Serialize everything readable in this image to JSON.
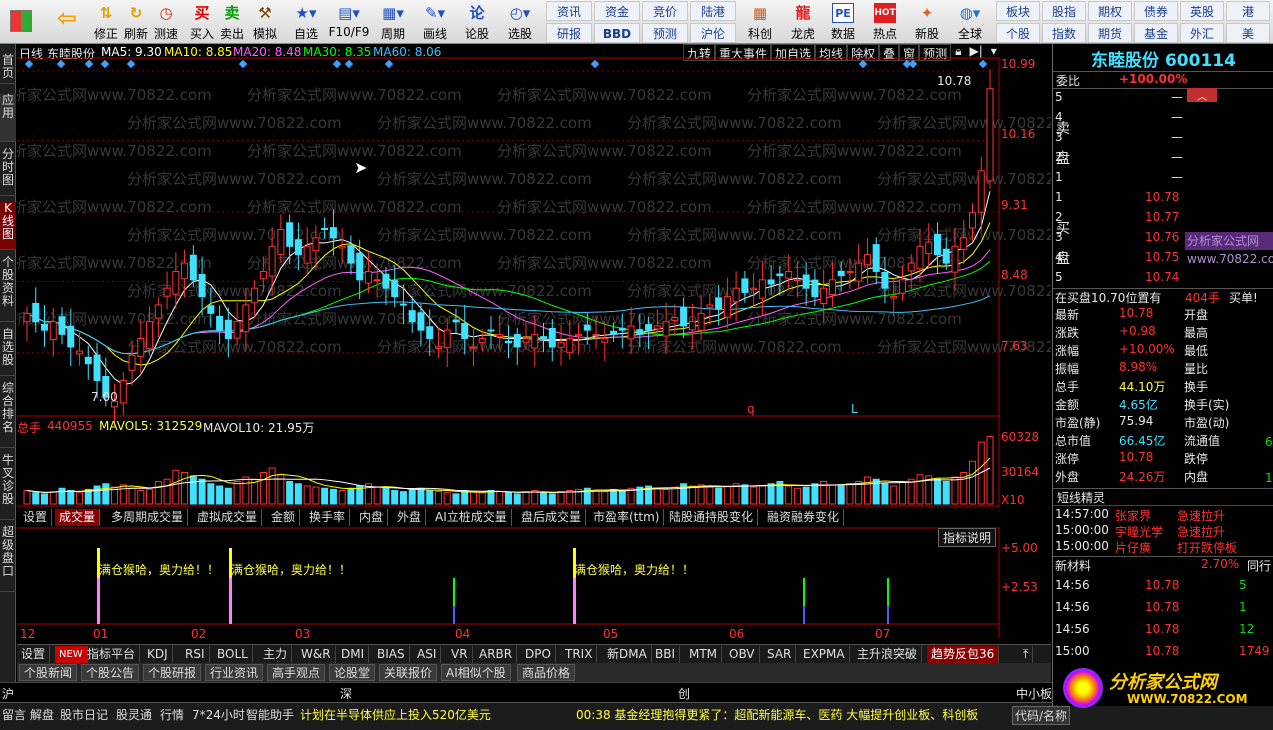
{
  "toolbar": {
    "buttons": [
      {
        "name": "home-button",
        "icon": "windows-grid-icon",
        "label": ""
      },
      {
        "name": "back-button",
        "icon": "back-arrow-icon",
        "label": ""
      },
      {
        "name": "adjust-button",
        "icon": "up-down-arrow-icon",
        "label": "修正"
      },
      {
        "name": "refresh-button",
        "icon": "refresh-icon",
        "label": "刷新"
      },
      {
        "name": "clock-button",
        "icon": "clock-icon",
        "label": "测速"
      },
      {
        "name": "buy-button",
        "icon": "buy-icon",
        "label": "买入",
        "glyph": "买"
      },
      {
        "name": "sell-button",
        "icon": "sell-icon",
        "label": "卖出",
        "glyph": "卖"
      },
      {
        "name": "simulate-button",
        "icon": "hammer-icon",
        "label": "模拟"
      },
      {
        "name": "watchlist-button",
        "icon": "star-icon",
        "label": "自选"
      },
      {
        "name": "f10-button",
        "icon": "f10-icon",
        "label": "F10/F9"
      },
      {
        "name": "period-button",
        "icon": "calendar-icon",
        "label": "周期"
      },
      {
        "name": "draw-button",
        "icon": "pen-icon",
        "label": "画线"
      },
      {
        "name": "discuss-button",
        "icon": "discuss-icon",
        "label": "论股"
      },
      {
        "name": "select-stock-button",
        "icon": "select-icon",
        "label": "选股"
      }
    ],
    "grid1": [
      "资讯",
      "资金",
      "竞价",
      "陆港",
      "",
      "",
      "研报",
      "BBD",
      "预测",
      "沪伦",
      "",
      ""
    ],
    "extra_buttons": [
      {
        "name": "kechuang-button",
        "label": "科创"
      },
      {
        "name": "dragon-button",
        "label": "龙虎"
      },
      {
        "name": "data-button",
        "label": "数据",
        "glyph": "PE"
      },
      {
        "name": "hot-button",
        "label": "热点",
        "glyph": "HOT"
      },
      {
        "name": "ipo-button",
        "label": "新股"
      },
      {
        "name": "global-button",
        "label": "全球"
      }
    ],
    "grid2": [
      "板块",
      "股指",
      "期权",
      "债券",
      "英股",
      "港",
      "个股",
      "指数",
      "期货",
      "基金",
      "外汇",
      "美"
    ]
  },
  "leftbar": [
    "首页",
    "应用",
    "分时图",
    "K线图",
    "个股资料",
    "自选股",
    "综合排名",
    "牛叉诊股",
    "超级盘口"
  ],
  "kline": {
    "period": "日线",
    "stock": "东睦股份",
    "ma": [
      {
        "label": "MA5: 9.30",
        "color": "#ffffff"
      },
      {
        "label": "MA10: 8.85",
        "color": "#ffff00"
      },
      {
        "label": "MA20: 8.48",
        "color": "#ff60ff"
      },
      {
        "label": "MA30: 8.35",
        "color": "#00ff00"
      },
      {
        "label": "MA60: 8.06",
        "color": "#40c0ff"
      }
    ],
    "menu": [
      "九转",
      "重大事件",
      "加自选",
      "均线",
      "除权",
      "叠",
      "窗",
      "预测"
    ],
    "yticks": [
      "10.99",
      "10.16",
      "9.31",
      "8.48",
      "7.63"
    ],
    "hi_label": "10.78",
    "lo_label": "7.00",
    "marker_q": "q",
    "marker_l": "L",
    "watermark": "分析家公式网www.70822.com"
  },
  "volume": {
    "label_total": "总手",
    "total": "440955",
    "mavol5": "MAVOL5: 312529",
    "mavol10": "MAVOL10: 21.95万",
    "yticks": [
      "60328",
      "30164",
      "X10"
    ]
  },
  "tabs": [
    "设置",
    "成交量",
    "多周期成交量",
    "虚拟成交量",
    "金额",
    "换手率",
    "内盘",
    "外盘",
    "AI立桩成交量",
    "盘后成交量",
    "市盈率(ttm)",
    "陆股通持股变化",
    "融资融券变化"
  ],
  "indicator": {
    "explain": "指标说明",
    "yticks": [
      "+5.00",
      "+2.53"
    ],
    "signal_text": "满仓猴哈，奥力给！！",
    "months": [
      "12",
      "01",
      "02",
      "03",
      "04",
      "05",
      "06",
      "07"
    ]
  },
  "ind_tabs": [
    "设置",
    "NEW",
    "指标平台",
    "KDJ",
    "RSI",
    "BOLL",
    "主力",
    "W&R",
    "DMI",
    "BIAS",
    "ASI",
    "VR",
    "ARBR",
    "DPO",
    "TRIX",
    "新DMA",
    "BBI",
    "MTM",
    "OBV",
    "SAR",
    "EXPMA",
    "主升浪突破",
    "趋势反包36"
  ],
  "news_tabs": [
    "个股新闻",
    "个股公告",
    "个股研报",
    "行业资讯",
    "高手观点",
    "论股堂",
    "关联报价",
    "AI相似个股",
    "商品价格"
  ],
  "index_bar": [
    "沪",
    "深",
    "创",
    "中小板"
  ],
  "status": {
    "items": [
      "留言",
      "解盘",
      "股市日记",
      "股灵通",
      "行情",
      "7*24小时",
      "智能助手"
    ],
    "ticker1": "计划在半导体供应上投入520亿美元",
    "ticker2": "00:38 基金经理抱得更紧了：超配新能源车、医药 大幅提升创业板、科创板",
    "code": "代码/名称"
  },
  "quote": {
    "title": "东睦股份 600114",
    "weibi_label": "委比",
    "weibi": "+100.00%",
    "sell_label": "卖盘",
    "buy_label": "买盘",
    "sell": [
      {
        "n": "5",
        "p": "—"
      },
      {
        "n": "4",
        "p": "—"
      },
      {
        "n": "3",
        "p": "—"
      },
      {
        "n": "2",
        "p": "—"
      },
      {
        "n": "1",
        "p": "—"
      }
    ],
    "buy": [
      {
        "n": "1",
        "p": "10.78"
      },
      {
        "n": "2",
        "p": "10.77"
      },
      {
        "n": "3",
        "p": "10.76"
      },
      {
        "n": "4",
        "p": "10.75"
      },
      {
        "n": "5",
        "p": "10.74"
      }
    ],
    "inbuy": "在买盘10.70位置有",
    "inbuy_qty": "404手",
    "inbuy_tag": "买单!",
    "stats": [
      {
        "l": "最新",
        "v": "10.78",
        "r": "开盘",
        "c": "red"
      },
      {
        "l": "涨跌",
        "v": "+0.98",
        "r": "最高",
        "c": "red"
      },
      {
        "l": "涨幅",
        "v": "+10.00%",
        "r": "最低",
        "c": "red"
      },
      {
        "l": "振幅",
        "v": "8.98%",
        "r": "量比",
        "c": "red"
      },
      {
        "l": "总手",
        "v": "44.10万",
        "r": "换手",
        "c": "yellow"
      },
      {
        "l": "金额",
        "v": "4.65亿",
        "r": "换手(实)",
        "c": "cyan"
      },
      {
        "l": "市盈(静)",
        "v": "75.94",
        "r": "市盈(动)",
        "c": "white"
      },
      {
        "l": "总市值",
        "v": "66.45亿",
        "r": "流通值",
        "c": "cyan"
      },
      {
        "l": "涨停",
        "v": "10.78",
        "r": "跌停",
        "c": "red"
      },
      {
        "l": "外盘",
        "v": "24.26万",
        "r": "内盘",
        "c": "red"
      }
    ],
    "flow_value": "6",
    "inner_value": "1",
    "short_title": "短线精灵",
    "short_rows": [
      {
        "t": "14:57:00",
        "n": "张家界",
        "e": "急速拉升"
      },
      {
        "t": "15:00:00",
        "n": "宇瞳光学",
        "e": "急速拉升"
      },
      {
        "t": "15:00:00",
        "n": "片仔癀",
        "e": "打开跌停板"
      }
    ],
    "sector": "新材料",
    "sector_pct": "2.70%",
    "sector_tag": "同行",
    "ticks": [
      {
        "t": "14:56",
        "p": "10.78",
        "v": "5",
        "c": "green"
      },
      {
        "t": "14:56",
        "p": "10.78",
        "v": "1",
        "c": "green"
      },
      {
        "t": "14:56",
        "p": "10.78",
        "v": "12",
        "c": "green"
      },
      {
        "t": "15:00",
        "p": "10.78",
        "v": "1749",
        "c": "red"
      }
    ],
    "logo_text": "分析家公式网",
    "logo_url": "WWW.70822.COM"
  },
  "chart_data": {
    "type": "candlestick",
    "title": "东睦股份 日线",
    "ylim": [
      6.9,
      11.05
    ],
    "months": [
      "12",
      "01",
      "02",
      "03",
      "04",
      "05",
      "06",
      "07"
    ],
    "close": [
      8.1,
      8.0,
      7.9,
      8.0,
      7.85,
      7.7,
      7.65,
      7.5,
      7.3,
      7.1,
      7.05,
      7.3,
      7.6,
      7.8,
      8.0,
      8.2,
      8.4,
      8.6,
      8.7,
      8.5,
      8.3,
      8.1,
      7.9,
      7.8,
      8.0,
      8.2,
      8.4,
      8.6,
      8.9,
      9.1,
      8.9,
      8.8,
      8.9,
      9.0,
      9.1,
      9.0,
      8.9,
      8.7,
      8.5,
      8.6,
      8.5,
      8.4,
      8.3,
      8.2,
      8.0,
      7.9,
      7.8,
      7.7,
      7.9,
      8.0,
      7.8,
      7.7,
      7.8,
      7.9,
      7.85,
      7.75,
      7.7,
      7.8,
      7.85,
      7.8,
      7.7,
      7.75,
      7.8,
      7.85,
      7.9,
      7.85,
      7.8,
      7.85,
      7.9,
      7.95,
      7.85,
      7.9,
      7.95,
      8.0,
      8.05,
      7.95,
      8.0,
      8.1,
      8.2,
      8.15,
      8.3,
      8.4,
      8.35,
      8.4,
      8.5,
      8.45,
      8.55,
      8.6,
      8.5,
      8.4,
      8.3,
      8.4,
      8.5,
      8.55,
      8.6,
      8.7,
      8.8,
      8.6,
      8.4,
      8.3,
      8.5,
      8.7,
      8.9,
      8.95,
      8.8,
      8.7,
      8.9,
      9.0,
      9.3,
      9.8,
      10.78
    ],
    "volume": [
      12,
      10,
      9,
      11,
      14,
      12,
      10,
      13,
      16,
      18,
      15,
      17,
      14,
      12,
      13,
      20,
      22,
      30,
      28,
      25,
      22,
      18,
      16,
      14,
      20,
      24,
      22,
      28,
      32,
      26,
      20,
      18,
      16,
      15,
      14,
      13,
      12,
      14,
      16,
      18,
      15,
      14,
      12,
      11,
      13,
      14,
      12,
      11,
      10,
      9,
      12,
      11,
      10,
      12,
      11,
      10,
      9,
      11,
      12,
      10,
      9,
      11,
      12,
      13,
      14,
      12,
      11,
      13,
      12,
      14,
      15,
      16,
      14,
      13,
      15,
      18,
      16,
      17,
      15,
      14,
      16,
      18,
      17,
      15,
      16,
      18,
      20,
      16,
      14,
      15,
      18,
      20,
      17,
      16,
      18,
      20,
      24,
      22,
      18,
      16,
      20,
      22,
      26,
      25,
      22,
      20,
      24,
      28,
      38,
      55,
      60
    ]
  }
}
